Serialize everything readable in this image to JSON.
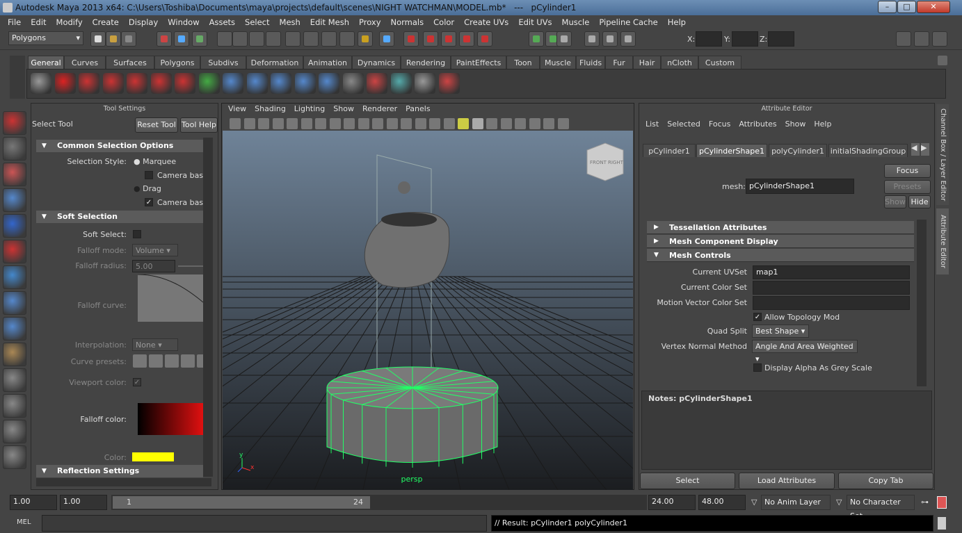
{
  "window": {
    "title": "Autodesk Maya 2013 x64: C:\\Users\\Toshiba\\Documents\\maya\\projects\\default\\scenes\\NIGHT WATCHMAN\\MODEL.mb*   ---   pCylinder1",
    "minimize": "–",
    "maximize": "□",
    "close": "✕"
  },
  "menus": [
    "File",
    "Edit",
    "Modify",
    "Create",
    "Display",
    "Window",
    "Assets",
    "Select",
    "Mesh",
    "Edit Mesh",
    "Proxy",
    "Normals",
    "Color",
    "Create UVs",
    "Edit UVs",
    "Muscle",
    "Pipeline Cache",
    "Help"
  ],
  "status": {
    "mode": "Polygons",
    "x_label": "X:",
    "y_label": "Y:",
    "z_label": "Z:",
    "x": "",
    "y": "",
    "z": ""
  },
  "shelf_tabs": [
    "General",
    "Curves",
    "Surfaces",
    "Polygons",
    "Subdivs",
    "Deformation",
    "Animation",
    "Dynamics",
    "Rendering",
    "PaintEffects",
    "Toon",
    "Muscle",
    "Fluids",
    "Fur",
    "Hair",
    "nCloth",
    "Custom"
  ],
  "shelf_active": "General",
  "tool_settings": {
    "header": "Tool Settings",
    "tool_name": "Select Tool",
    "reset": "Reset Tool",
    "help": "Tool Help",
    "common_frame": "Common Selection Options",
    "selection_style_label": "Selection Style:",
    "marquee": "Marquee",
    "camera_based1": "Camera based",
    "drag": "Drag",
    "camera_based2": "Camera based",
    "soft_frame": "Soft Selection",
    "soft_select_label": "Soft Select:",
    "falloff_mode_label": "Falloff mode:",
    "falloff_mode": "Volume",
    "falloff_radius_label": "Falloff radius:",
    "falloff_radius": "5.00",
    "falloff_curve_label": "Falloff curve:",
    "interpolation_label": "Interpolation:",
    "interpolation": "None",
    "curve_presets_label": "Curve presets:",
    "viewport_color_label": "Viewport color:",
    "falloff_color_label": "Falloff color:",
    "color_label": "Color:",
    "color_value": "#ffff00",
    "reflection_frame": "Reflection Settings"
  },
  "viewport": {
    "menus": [
      "View",
      "Shading",
      "Lighting",
      "Show",
      "Renderer",
      "Panels"
    ],
    "cube_front": "FRONT",
    "cube_right": "RIGHT",
    "camera": "persp",
    "axis_y": "y",
    "axis_x": "x",
    "wire_color": "#22ff66"
  },
  "attribute_editor": {
    "header": "Attribute Editor",
    "menus": [
      "List",
      "Selected",
      "Focus",
      "Attributes",
      "Show",
      "Help"
    ],
    "tabs": [
      "pCylinder1",
      "pCylinderShape1",
      "polyCylinder1",
      "initialShadingGroup"
    ],
    "active_tab": "pCylinderShape1",
    "mesh_label": "mesh:",
    "mesh_value": "pCylinderShape1",
    "focus": "Focus",
    "presets": "Presets",
    "show": "Show",
    "hide": "Hide",
    "frames": [
      "Tessellation Attributes",
      "Mesh Component Display",
      "Mesh Controls"
    ],
    "current_uvset_label": "Current UVSet",
    "current_uvset": "map1",
    "current_colorset_label": "Current Color Set",
    "current_colorset": "",
    "mvcs_label": "Motion Vector Color Set",
    "mvcs": "",
    "allow_topology": "Allow Topology Mod",
    "quad_split_label": "Quad Split",
    "quad_split": "Best Shape",
    "vnm_label": "Vertex Normal Method",
    "vnm": "Angle And Area Weighted",
    "display_alpha": "Display Alpha As Grey Scale",
    "notes_label": "Notes:  pCylinderShape1",
    "notes": "",
    "select": "Select",
    "load": "Load Attributes",
    "copy": "Copy Tab"
  },
  "side_tabs": [
    "Channel Box / Layer Editor",
    "Attribute Editor"
  ],
  "time": {
    "start": "1.00",
    "current": "1.00",
    "range_start": "1",
    "range_end": "24",
    "end": "24.00",
    "max": "48.00",
    "anim_layer": "No Anim Layer",
    "char_set": "No Character Set"
  },
  "command": {
    "lang": "MEL",
    "input": "",
    "result": "// Result: pCylinder1 polyCylinder1"
  }
}
